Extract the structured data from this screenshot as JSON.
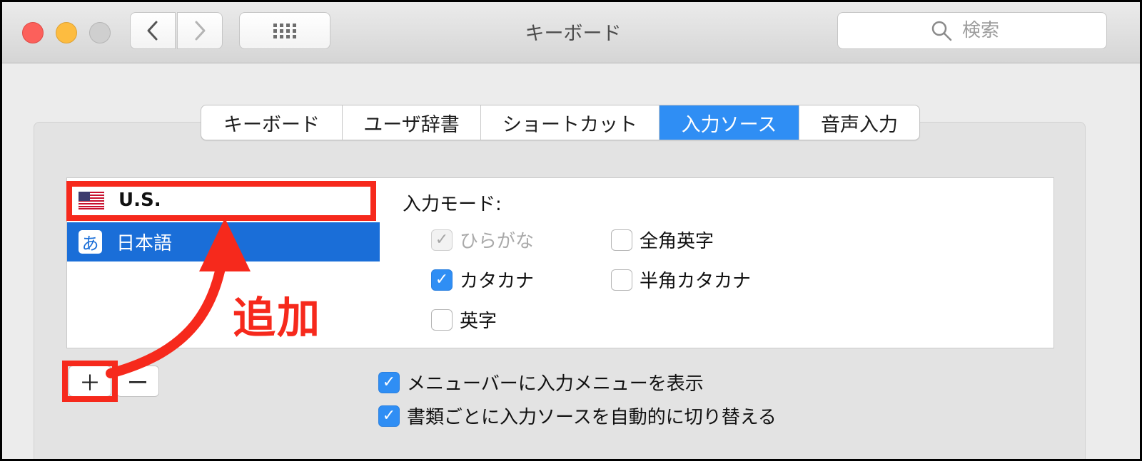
{
  "window": {
    "title": "キーボード"
  },
  "toolbar": {
    "search_placeholder": "検索"
  },
  "tabs": [
    {
      "label": "キーボード",
      "active": false
    },
    {
      "label": "ユーザ辞書",
      "active": false
    },
    {
      "label": "ショートカット",
      "active": false
    },
    {
      "label": "入力ソース",
      "active": true
    },
    {
      "label": "音声入力",
      "active": false
    }
  ],
  "sources": [
    {
      "label": "U.S.",
      "icon": "us-flag-icon",
      "selected": false
    },
    {
      "label": "日本語",
      "icon": "あ",
      "selected": true
    }
  ],
  "detail": {
    "mode_label": "入力モード:",
    "modes": [
      {
        "label": "ひらがな",
        "checked": true,
        "disabled": true
      },
      {
        "label": "全角英字",
        "checked": false,
        "disabled": false
      },
      {
        "label": "カタカナ",
        "checked": true,
        "disabled": false
      },
      {
        "label": "半角カタカナ",
        "checked": false,
        "disabled": false
      },
      {
        "label": "英字",
        "checked": false,
        "disabled": false
      }
    ]
  },
  "buttons": {
    "add": "＋",
    "remove": "ー"
  },
  "options": [
    {
      "label": "メニューバーに入力メニューを表示",
      "checked": true
    },
    {
      "label": "書類ごとに入力ソースを自動的に切り替える",
      "checked": true
    }
  ],
  "annotation": {
    "text": "追加",
    "color": "#f6291c"
  },
  "colors": {
    "accent": "#2f8ef4",
    "selection": "#1a6ed8"
  }
}
